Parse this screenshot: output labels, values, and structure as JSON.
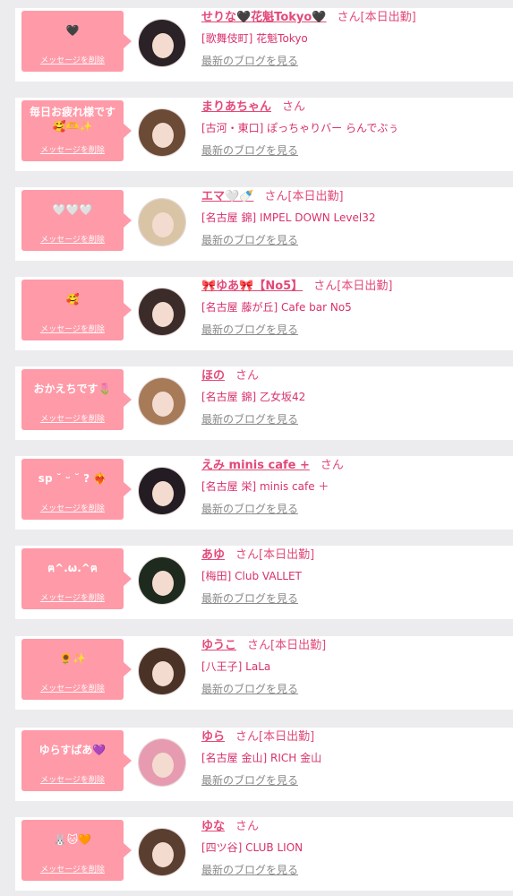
{
  "delete_label": "メッセージを削除",
  "blog_label": "最新のブログを見る",
  "honorific": "さん",
  "colors": {
    "bubble": "#ff9aa8",
    "name": "#e24a79",
    "shop": "#d8316c",
    "link_gray": "#8a8a8a",
    "page_bg": "#ececee"
  },
  "messages": [
    {
      "message": "🖤",
      "name": "せりな🖤花魁Tokyo🖤",
      "badge": "[本日出勤]",
      "shop": "[歌舞伎町] 花魁Tokyo",
      "hair": "#2a2226"
    },
    {
      "message": "毎日お疲れ様です\n🥰🫶✨",
      "name": "まりあちゃん",
      "badge": "",
      "shop": "[古河・東口] ぽっちゃりバー らんでぶぅ",
      "hair": "#6b4a36"
    },
    {
      "message": "🤍🤍🤍",
      "name": "エマ🤍🍼",
      "badge": "[本日出勤]",
      "shop": "[名古屋 錦] IMPEL DOWN Level32",
      "hair": "#d9c4a6"
    },
    {
      "message": "🥰",
      "name": "🎀ゆあ🎀【No5】",
      "badge": "[本日出勤]",
      "shop": "[名古屋 藤が丘] Cafe bar No5",
      "hair": "#3b2c2a"
    },
    {
      "message": "おかえちです🌷",
      "name": "ほの",
      "badge": "",
      "shop": "[名古屋 錦] 乙女坂42",
      "hair": "#a77a58"
    },
    {
      "message": "sp ˘ ᵕ ˘ ? ❤️‍🔥",
      "name": "えみ minis cafe +",
      "badge": "",
      "shop": "[名古屋 栄] minis cafe ＋",
      "hair": "#231c22"
    },
    {
      "message": "ฅ^.ω.^ฅ",
      "name": "あゆ",
      "badge": "[本日出勤]",
      "shop": "[梅田] Club VALLET",
      "hair": "#1f2a1e"
    },
    {
      "message": "🌻✨",
      "name": "ゆうこ",
      "badge": "[本日出勤]",
      "shop": "[八王子] LaLa",
      "hair": "#4a3226"
    },
    {
      "message": "ゆらすばあ💜",
      "name": "ゆら",
      "badge": "[本日出勤]",
      "shop": "[名古屋 金山] RICH 金山",
      "hair": "#e79bb0"
    },
    {
      "message": "🐰🐱🧡",
      "name": "ゆな",
      "badge": "",
      "shop": "[四ツ谷] CLUB LION",
      "hair": "#5a3e30"
    }
  ]
}
